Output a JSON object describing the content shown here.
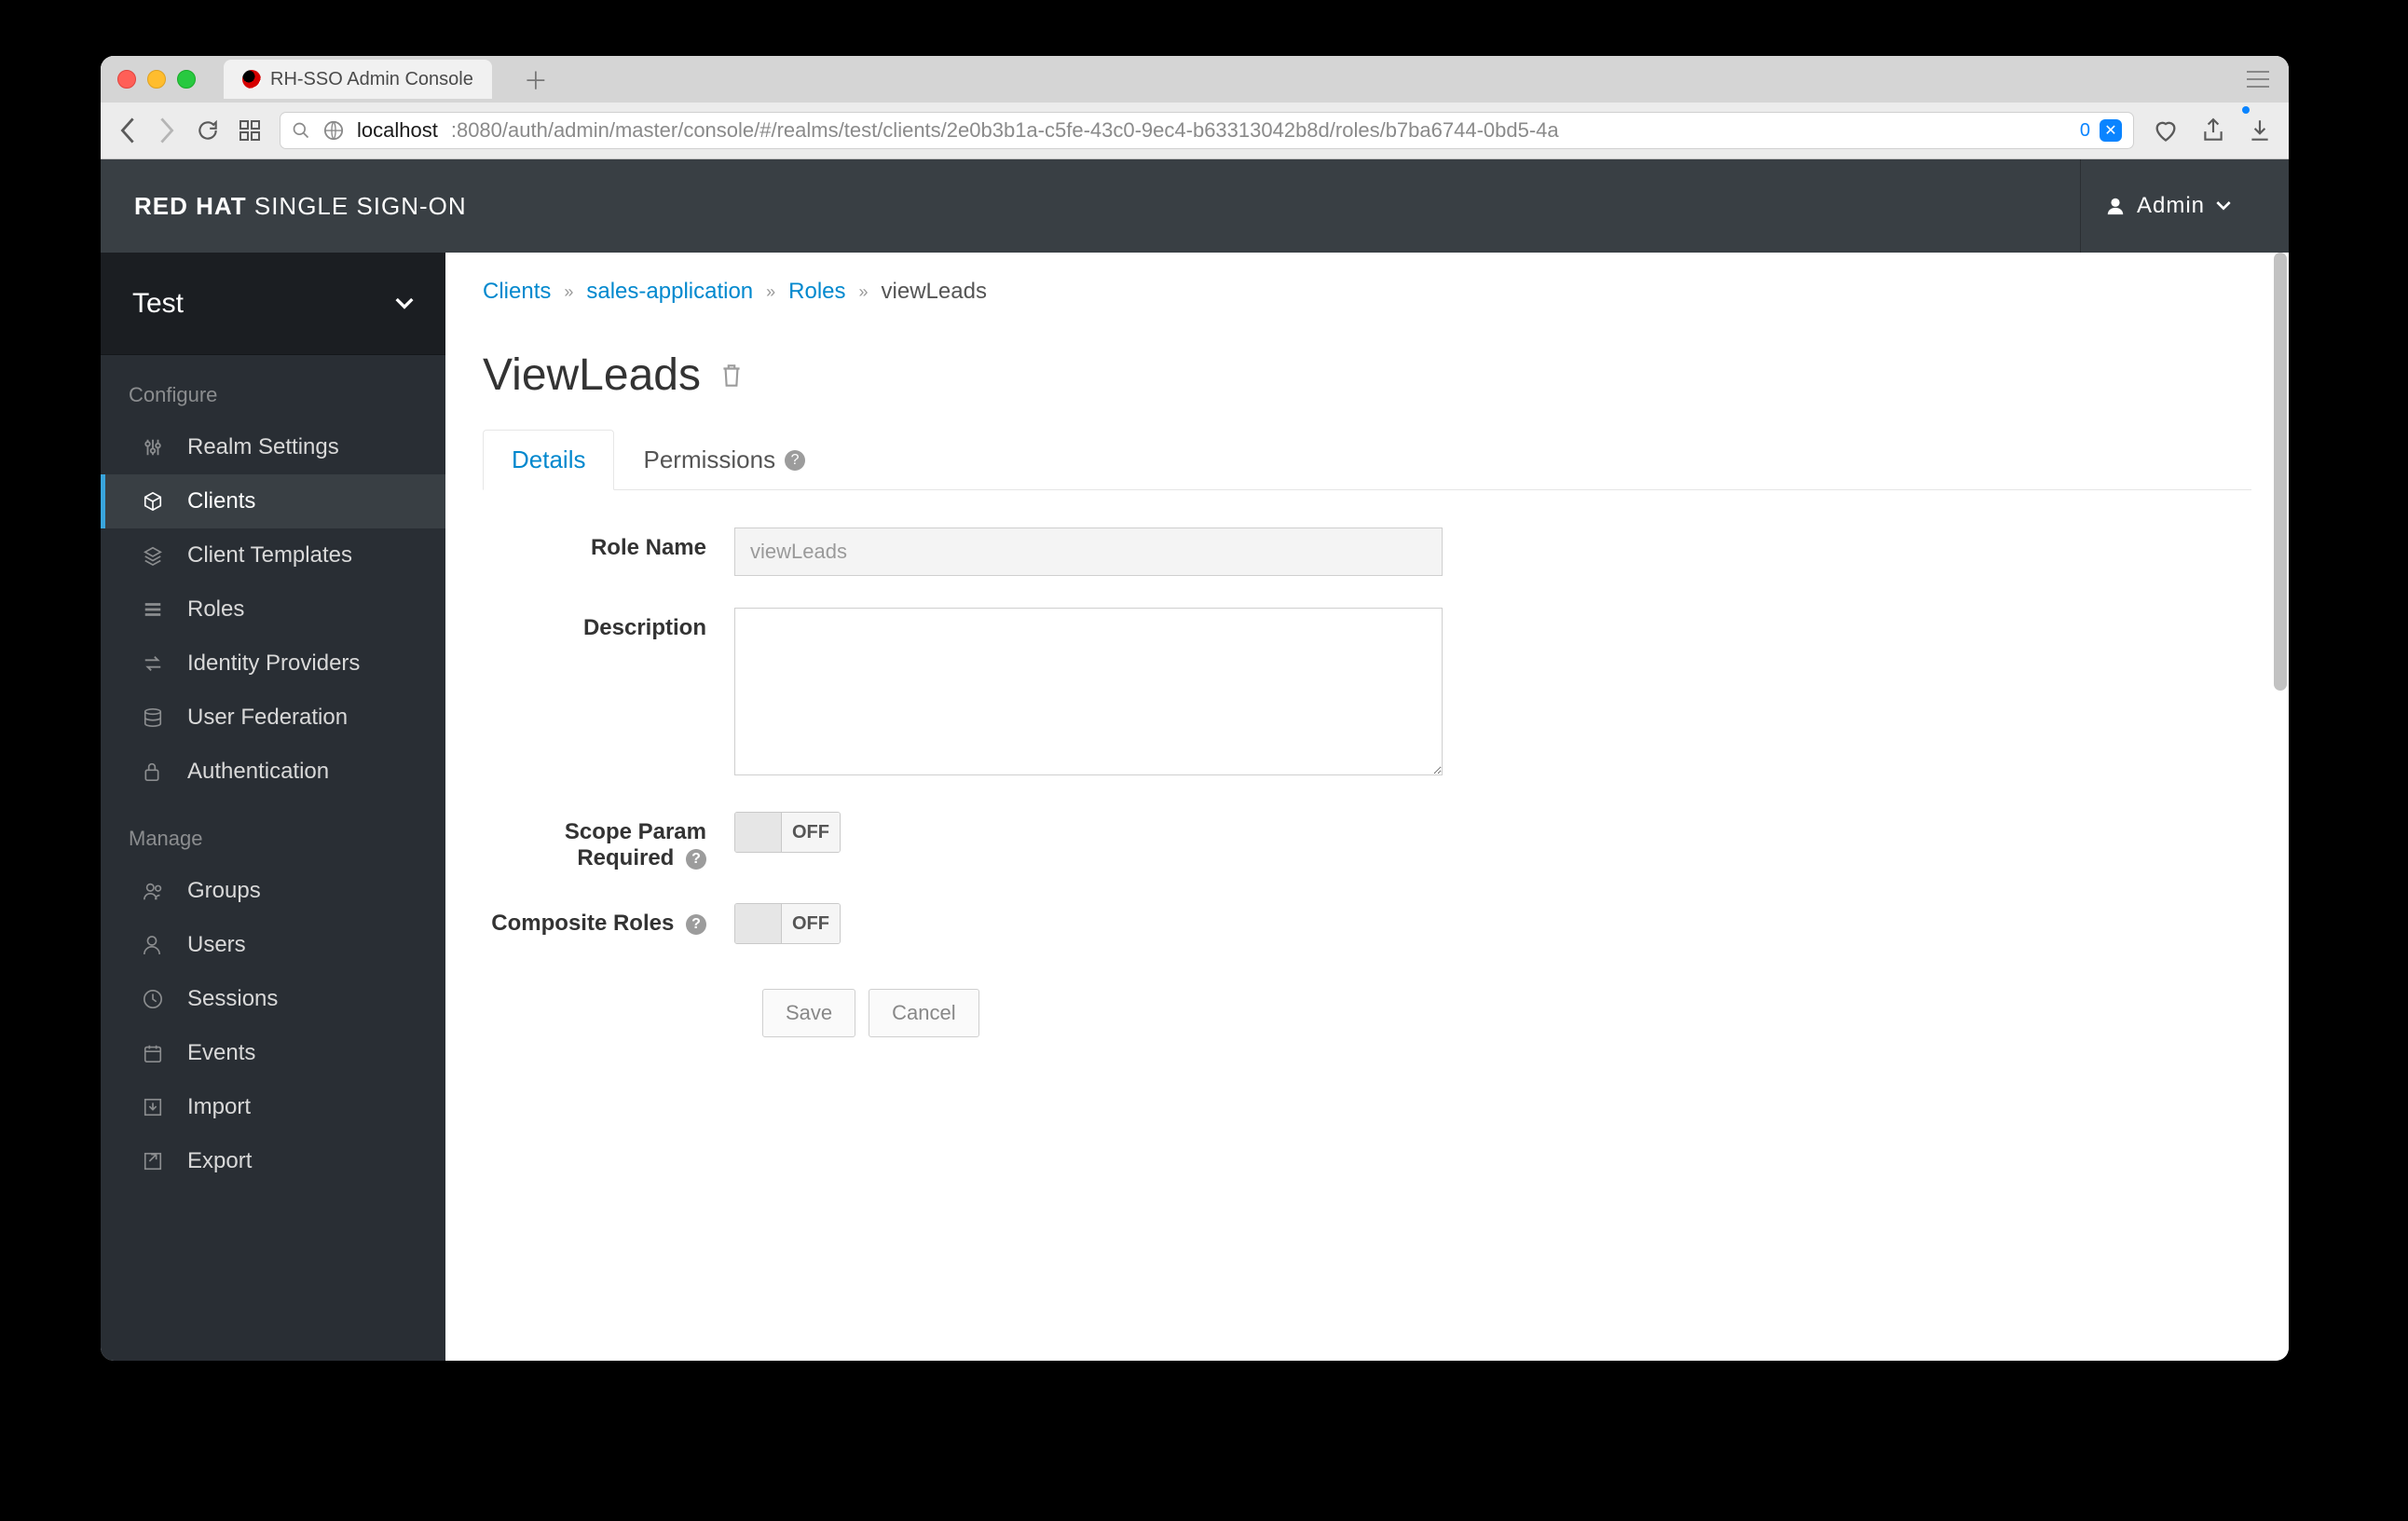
{
  "browser": {
    "tab_title": "RH-SSO Admin Console",
    "url_host": "localhost",
    "url_rest": ":8080/auth/admin/master/console/#/realms/test/clients/2e0b3b1a-c5fe-43c0-9ec4-b63313042b8d/roles/b7ba6744-0bd5-4a",
    "badge_count": "0"
  },
  "header": {
    "brand_bold": "RED HAT",
    "brand_thin": "SINGLE SIGN-ON",
    "user_label": "Admin"
  },
  "sidebar": {
    "realm": "Test",
    "section_configure": "Configure",
    "section_manage": "Manage",
    "configure_items": [
      {
        "icon": "sliders",
        "label": "Realm Settings"
      },
      {
        "icon": "cube",
        "label": "Clients"
      },
      {
        "icon": "layers",
        "label": "Client Templates"
      },
      {
        "icon": "list",
        "label": "Roles"
      },
      {
        "icon": "exchange",
        "label": "Identity Providers"
      },
      {
        "icon": "database",
        "label": "User Federation"
      },
      {
        "icon": "lock",
        "label": "Authentication"
      }
    ],
    "manage_items": [
      {
        "icon": "users",
        "label": "Groups"
      },
      {
        "icon": "user",
        "label": "Users"
      },
      {
        "icon": "clock",
        "label": "Sessions"
      },
      {
        "icon": "calendar",
        "label": "Events"
      },
      {
        "icon": "import",
        "label": "Import"
      },
      {
        "icon": "export",
        "label": "Export"
      }
    ],
    "active_label": "Clients"
  },
  "breadcrumb": {
    "items": [
      "Clients",
      "sales-application",
      "Roles",
      "viewLeads"
    ]
  },
  "page": {
    "title": "ViewLeads",
    "tabs": {
      "details": "Details",
      "permissions": "Permissions"
    },
    "form": {
      "role_name_label": "Role Name",
      "role_name_value": "viewLeads",
      "description_label": "Description",
      "description_value": "",
      "scope_param_label": "Scope Param Required",
      "scope_param_state": "OFF",
      "composite_label": "Composite Roles",
      "composite_state": "OFF",
      "save": "Save",
      "cancel": "Cancel"
    }
  }
}
